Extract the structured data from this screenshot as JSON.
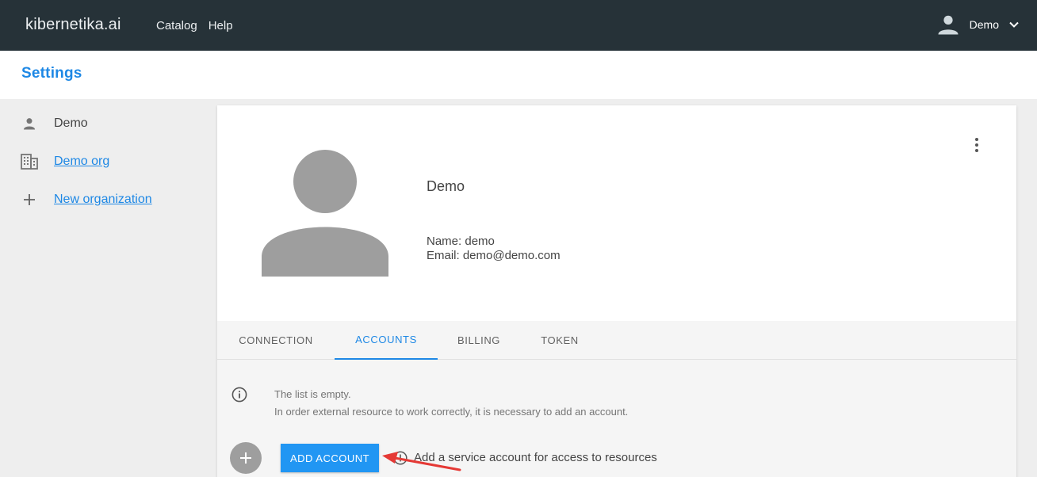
{
  "header": {
    "brand": "kibernetika.ai",
    "nav": [
      "Catalog",
      "Help"
    ],
    "user_name": "Demo"
  },
  "settings": {
    "title": "Settings"
  },
  "sidebar": {
    "items": [
      {
        "label": "Demo",
        "icon": "person-icon",
        "link": false
      },
      {
        "label": "Demo org",
        "icon": "building-icon",
        "link": true
      },
      {
        "label": "New organization",
        "icon": "plus-icon",
        "link": true
      }
    ]
  },
  "profile": {
    "name": "Demo",
    "name_line": "Name: demo",
    "email_line": "Email: demo@demo.com"
  },
  "tabs": [
    {
      "label": "CONNECTION",
      "active": false
    },
    {
      "label": "ACCOUNTS",
      "active": true
    },
    {
      "label": "BILLING",
      "active": false
    },
    {
      "label": "TOKEN",
      "active": false
    }
  ],
  "accounts": {
    "empty_line1": "The list is empty.",
    "empty_line2": "In order external resource to work correctly, it is necessary to add an account.",
    "add_button": "ADD ACCOUNT",
    "hint": "Add a service account for access to resources"
  },
  "colors": {
    "topbar": "#263238",
    "accent": "#1e88e5",
    "button": "#2196f3",
    "annotation": "#e53935"
  }
}
